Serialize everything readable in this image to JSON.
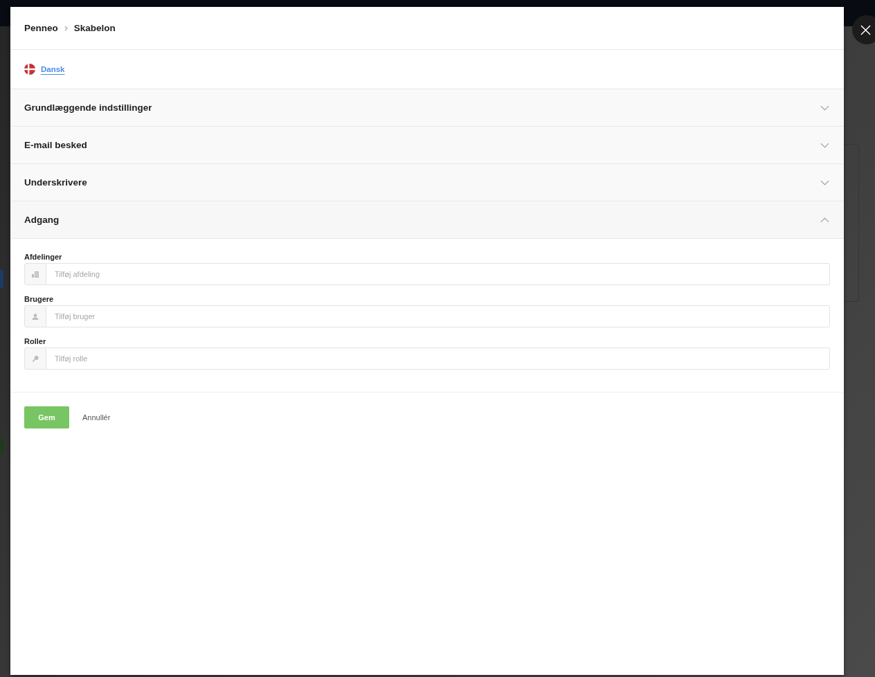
{
  "breadcrumb": [
    {
      "label": "Penneo"
    },
    {
      "label": "Skabelon"
    }
  ],
  "language": {
    "label": "Dansk"
  },
  "sections": [
    {
      "title": "Grundlæggende indstillinger",
      "expanded": false
    },
    {
      "title": "E-mail besked",
      "expanded": false
    },
    {
      "title": "Underskrivere",
      "expanded": false
    },
    {
      "title": "Adgang",
      "expanded": true,
      "fields": [
        {
          "kind": "department",
          "label": "Afdelinger",
          "placeholder": "Tilføj afdeling"
        },
        {
          "kind": "user",
          "label": "Brugere",
          "placeholder": "Tilføj bruger"
        },
        {
          "kind": "role",
          "label": "Roller",
          "placeholder": "Tilføj rolle"
        }
      ]
    }
  ],
  "buttons": [
    {
      "kind": "primary",
      "label": "Gem"
    },
    {
      "kind": "link",
      "label": "Annullér"
    }
  ]
}
